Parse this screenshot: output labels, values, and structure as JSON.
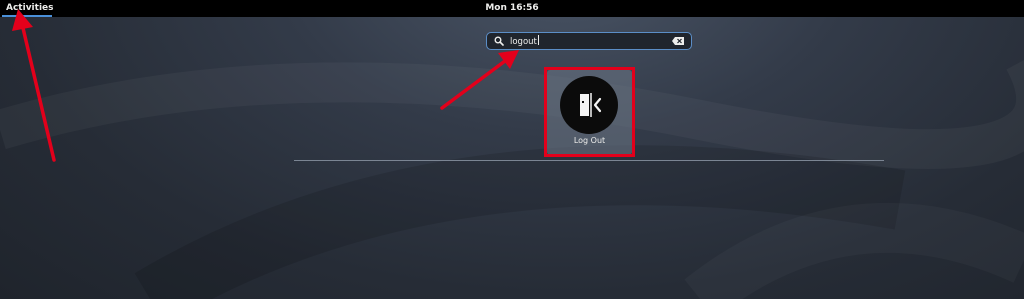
{
  "top_bar": {
    "activities_label": "Activities",
    "clock": "Mon 16:56"
  },
  "search": {
    "query": "logout",
    "icon": "search-icon",
    "clear_icon": "clear-text-icon"
  },
  "results": [
    {
      "label": "Log Out",
      "icon": "logout-icon"
    }
  ],
  "colors": {
    "top_bar": "#000000",
    "accent": "#4a90d9",
    "annotation": "#e3001b"
  }
}
